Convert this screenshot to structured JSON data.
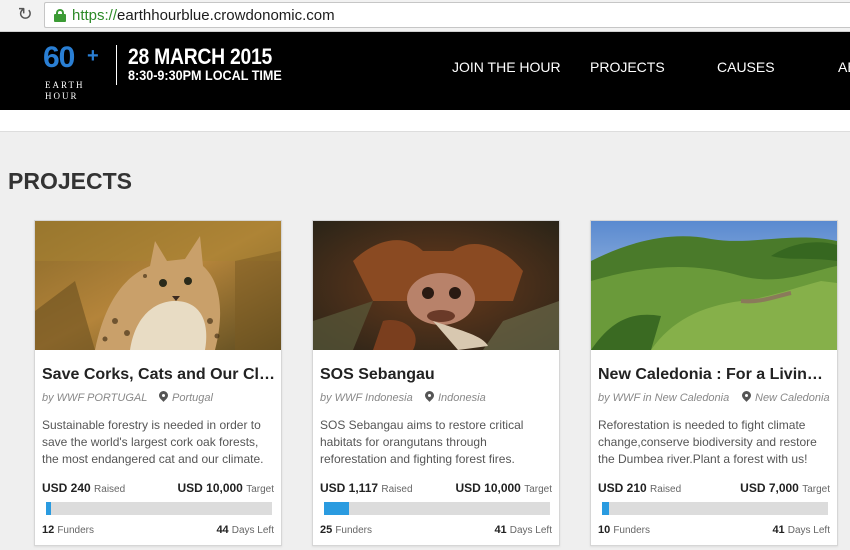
{
  "browser": {
    "url_scheme": "https://",
    "url_host": "earthhourblue.crowdonomic.com"
  },
  "header": {
    "logo_number": "60",
    "logo_plus": "+",
    "logo_line1": "EARTH",
    "logo_line2": "HOUR",
    "event_date": "28 MARCH 2015",
    "event_time": "8:30-9:30PM LOCAL TIME",
    "nav": [
      "JOIN THE HOUR",
      "PROJECTS",
      "CAUSES",
      "AB"
    ]
  },
  "page": {
    "title": "PROJECTS"
  },
  "projects": [
    {
      "title": "Save Corks, Cats and Our Climate",
      "org": "by WWF PORTUGAL",
      "location": "Portugal",
      "description": "Sustainable forestry is needed in order to save the world's largest cork oak forests, the most endangered cat and our climate.",
      "raised_amount": "USD 240",
      "raised_label": "Raised",
      "target_amount": "USD 10,000",
      "target_label": "Target",
      "progress_fraction": 0.024,
      "funders_count": "12",
      "funders_label": "Funders",
      "days_count": "44",
      "days_label": "Days Left",
      "image": "lynx-photo"
    },
    {
      "title": "SOS Sebangau",
      "org": "by WWF Indonesia",
      "location": "Indonesia",
      "description": "SOS Sebangau aims to restore critical habitats for orangutans through reforestation and fighting forest fires.",
      "raised_amount": "USD 1,117",
      "raised_label": "Raised",
      "target_amount": "USD 10,000",
      "target_label": "Target",
      "progress_fraction": 0.1117,
      "funders_count": "25",
      "funders_label": "Funders",
      "days_count": "41",
      "days_label": "Days Left",
      "image": "orangutan-photo"
    },
    {
      "title": "New Caledonia : For a Living Reef",
      "org": "by WWF in New Caledonia",
      "location": "New Caledonia",
      "description": "Reforestation is needed to fight climate change,conserve biodiversity and restore the Dumbea river.Plant a forest with us!",
      "raised_amount": "USD 210",
      "raised_label": "Raised",
      "target_amount": "USD 7,000",
      "target_label": "Target",
      "progress_fraction": 0.03,
      "funders_count": "10",
      "funders_label": "Funders",
      "days_count": "41",
      "days_label": "Days Left",
      "image": "valley-photo"
    }
  ],
  "colors": {
    "accent": "#2a9be0",
    "header_bg": "#000000",
    "logo_blue": "#2a7fd4",
    "secure_green": "#3c9b35"
  }
}
